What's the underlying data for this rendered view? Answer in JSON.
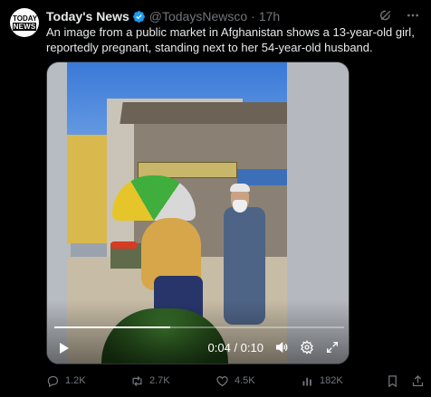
{
  "author": {
    "avatar_line1": "TODAY'S",
    "avatar_line2": "NEWS",
    "name": "Today's News",
    "handle": "@TodaysNewsco",
    "separator": "·",
    "time": "17h"
  },
  "tweet_text": "An image from a public market in Afghanistan shows a 13-year-old girl, reportedly pregnant, standing next to her 54-year-old husband.",
  "video": {
    "timecode": "0:04 / 0:10",
    "progress": 0.4
  },
  "actions": {
    "reply_count": "1.2K",
    "repost_count": "2.7K",
    "like_count": "4.5K",
    "view_count": "182K"
  },
  "colors": {
    "verified": "#1d9bf0",
    "muted": "#71767b",
    "background": "#000000"
  },
  "icons": [
    "grok-icon",
    "more-icon",
    "verified-badge-icon",
    "play-icon",
    "volume-icon",
    "settings-icon",
    "fullscreen-icon",
    "reply-icon",
    "repost-icon",
    "like-icon",
    "views-icon",
    "bookmark-icon",
    "share-icon"
  ]
}
